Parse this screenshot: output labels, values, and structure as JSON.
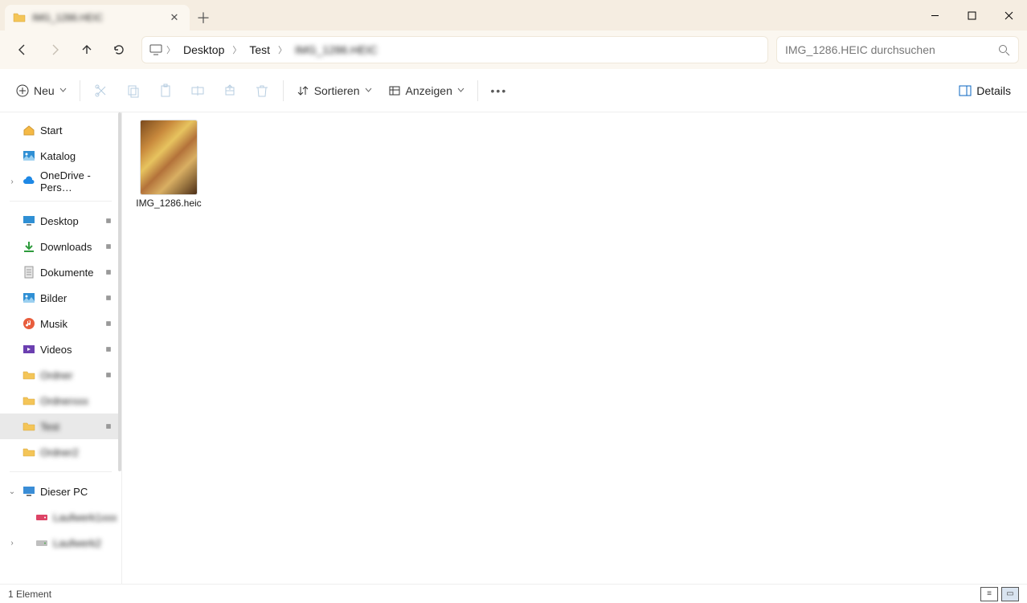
{
  "tab": {
    "title": "IMG_1286.HEIC"
  },
  "nav": {
    "back": "←",
    "forward": "→",
    "up": "↑",
    "refresh": "⟳"
  },
  "breadcrumbs": {
    "root_icon": "monitor",
    "items": [
      "Desktop",
      "Test",
      "IMG_1286.HEIC"
    ],
    "blurred": [
      false,
      false,
      true
    ]
  },
  "search": {
    "placeholder": "IMG_1286.HEIC durchsuchen"
  },
  "toolbar": {
    "new": "Neu",
    "sort": "Sortieren",
    "view": "Anzeigen",
    "details": "Details"
  },
  "sidebar": {
    "top": [
      {
        "label": "Start",
        "icon": "home",
        "pre": "",
        "pin": false
      },
      {
        "label": "Katalog",
        "icon": "gallery",
        "pre": "",
        "pin": false
      },
      {
        "label": "OneDrive - Pers…",
        "icon": "cloud",
        "pre": "›",
        "pin": false
      }
    ],
    "quick": [
      {
        "label": "Desktop",
        "icon": "desktop",
        "pin": true
      },
      {
        "label": "Downloads",
        "icon": "download",
        "pin": true
      },
      {
        "label": "Dokumente",
        "icon": "doc",
        "pin": true
      },
      {
        "label": "Bilder",
        "icon": "gallery",
        "pin": true
      },
      {
        "label": "Musik",
        "icon": "music",
        "pin": true
      },
      {
        "label": "Videos",
        "icon": "video",
        "pin": true
      },
      {
        "label": "Ordner",
        "icon": "folder",
        "pin": true,
        "blur": true
      },
      {
        "label": "Ordnerxxx",
        "icon": "folder",
        "pin": false,
        "blur": true
      },
      {
        "label": "Test",
        "icon": "folder",
        "pin": true,
        "blur": true,
        "selected": true
      },
      {
        "label": "Ordner2",
        "icon": "folder",
        "pin": false,
        "blur": true
      }
    ],
    "pc": [
      {
        "label": "Dieser PC",
        "icon": "pc",
        "pre": "⌄"
      },
      {
        "label": "Laufwerk1xxx",
        "icon": "drivep",
        "blur": true
      },
      {
        "label": "Laufwerk2",
        "icon": "drive",
        "blur": true,
        "pre": "›"
      }
    ]
  },
  "files": [
    {
      "name": "IMG_1286.heic"
    }
  ],
  "status": {
    "count": "1 Element"
  }
}
